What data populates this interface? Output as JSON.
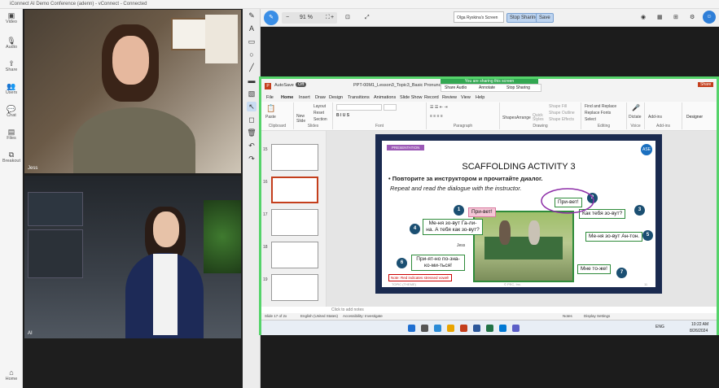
{
  "window": {
    "title": "iConnect AI Demo Conference (adenn) - vConnect - Connected"
  },
  "leftbar": [
    {
      "icon": "video-icon",
      "label": "Video"
    },
    {
      "icon": "audio-icon",
      "label": "Audio"
    },
    {
      "icon": "share-icon",
      "label": "Share"
    },
    {
      "icon": "users-icon",
      "label": "Users"
    },
    {
      "icon": "chat-icon",
      "label": "Chat"
    },
    {
      "icon": "files-icon",
      "label": "Files"
    },
    {
      "icon": "breakout-icon",
      "label": "Breakout"
    }
  ],
  "home": {
    "label": "Home"
  },
  "videos": [
    {
      "name": "Jess"
    },
    {
      "name": "AI"
    }
  ],
  "whiteboard_toolbar": {
    "zoom_minus": "−",
    "zoom": "91 %",
    "zoom_plus": "+",
    "screen_select": "Olga Ryskina's Screen",
    "stop_sharing": "Stop Sharing",
    "save": "Save"
  },
  "ppt": {
    "autosave": "AutoSave",
    "autosave_state": "Off",
    "filename": "PPT-00M1_Lesson3_Topic3_Basic Pronunciation - updated",
    "share_banner": "You are sharing this screen",
    "share_audio": "Share Audio",
    "annotate": "Annotate",
    "stop_sharing": "Stop Sharing",
    "share_btn": "Share"
  },
  "ribbon_tabs": [
    "File",
    "Home",
    "Insert",
    "Draw",
    "Design",
    "Transitions",
    "Animations",
    "Slide Show",
    "Record",
    "Review",
    "View",
    "Help"
  ],
  "ribbon_groups": [
    "Clipboard",
    "Slides",
    "Font",
    "Paragraph",
    "Drawing",
    "Editing",
    "Voice",
    "Add-ins"
  ],
  "ribbon_buttons": {
    "paste": "Paste",
    "new_slide": "New Slide",
    "layout": "Layout",
    "reset": "Reset",
    "section": "Section",
    "shapes": "Shapes",
    "arrange": "Arrange",
    "quick_styles": "Quick Styles",
    "shape_fill": "Shape Fill",
    "shape_outline": "Shape Outline",
    "shape_effects": "Shape Effects",
    "find": "Find and Replace",
    "replace_fonts": "Replace Fonts",
    "select": "Select",
    "dictate": "Dictate",
    "addins": "Add-ins",
    "designer": "Designer"
  },
  "thumbs": [
    "15",
    "16",
    "17",
    "18",
    "19",
    "20"
  ],
  "slide": {
    "presentation": "PRESENTATION",
    "title": "SCAFFOLDING ACTIVITY 3",
    "instr_ru": "Повторите за инструктором и прочитайте диалог.",
    "instr_en": "Repeat and read the dialogue with the instructor.",
    "logo": "ASE",
    "lines": [
      {
        "n": "1",
        "text": "При-вет!"
      },
      {
        "n": "2",
        "text": "При-вет!"
      },
      {
        "n": "3",
        "text": "Как тебя зо-вут?"
      },
      {
        "n": "4",
        "text": "Ме-ня зо-вут Га-ли-на. А тебя как зо-вут?"
      },
      {
        "n": "5",
        "text": "Ме-ня зо-вут Ан-тон."
      },
      {
        "n": "6",
        "text": "При-ят-но по-зна-ко-ми-ться!"
      },
      {
        "n": "7",
        "text": "Мне то-же!"
      }
    ],
    "cursor_label": "Jess",
    "note": "Note: Red indicates stressed vowel!",
    "footer_left": "TOPIC (THEME)",
    "footer_mid": "© PEC, Inc.",
    "footer_right": "11"
  },
  "notes": "Click to add notes",
  "status": {
    "slide": "Slide 17 of 2x",
    "lang": "English (United States)",
    "access": "Accessibility: Investigate",
    "notes": "Notes",
    "display": "Display Settings"
  },
  "taskbar": {
    "lang": "ENG",
    "time": "10:22 AM",
    "date": "8/26/2024"
  }
}
